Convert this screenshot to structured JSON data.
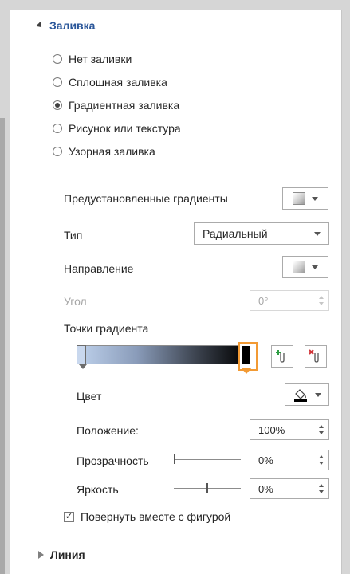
{
  "fill": {
    "title": "Заливка",
    "options": [
      {
        "label": "Нет заливки",
        "selected": false
      },
      {
        "label": "Сплошная заливка",
        "selected": false
      },
      {
        "label": "Градиентная заливка",
        "selected": true
      },
      {
        "label": "Рисунок или текстура",
        "selected": false
      },
      {
        "label": "Узорная заливка",
        "selected": false
      }
    ],
    "preset_label": "Предустановленные градиенты",
    "type_label": "Тип",
    "type_value": "Радиальный",
    "direction_label": "Направление",
    "angle_label": "Угол",
    "angle_value": "0°",
    "stops_label": "Точки градиента",
    "color_label": "Цвет",
    "position_label": "Положение:",
    "position_value": "100%",
    "transparency_label": "Прозрачность",
    "transparency_value": "0%",
    "brightness_label": "Яркость",
    "brightness_value": "0%",
    "rotate_label": "Повернуть вместе с фигурой",
    "rotate_checked": true
  },
  "line": {
    "title": "Линия"
  },
  "colors": {
    "accent": "#2b579a",
    "selected_stop": "#f29a34"
  }
}
